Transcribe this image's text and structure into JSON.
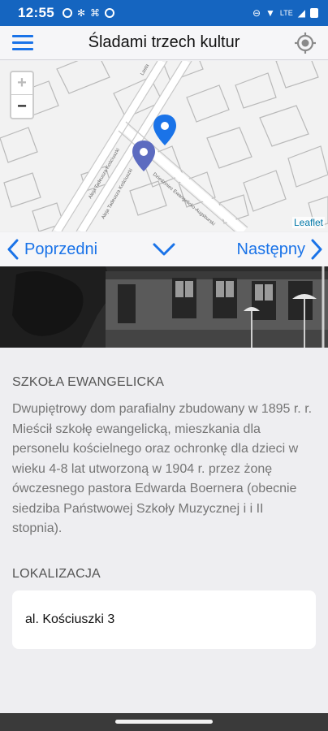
{
  "status_bar": {
    "time": "12:55",
    "network_label": "LTE"
  },
  "app_bar": {
    "title": "Śladami trzech kultur",
    "menu_icon": "hamburger-menu-icon",
    "locate_icon": "gps-locate-icon"
  },
  "map": {
    "attribution": "Leaflet",
    "zoom_in": "+",
    "zoom_out": "−",
    "street_labels": [
      "Lasta",
      "Aleja Tadeusza Kościuszki",
      "Aleja Tadeusza Kościuszki",
      "Dziedziniec Ewangelicko-Augsburski"
    ],
    "marker_active_color": "#1a73e8",
    "marker_inactive_color": "#5c6bc0"
  },
  "navigation": {
    "previous_label": "Poprzedni",
    "next_label": "Następny",
    "accent_color": "#1a73e8"
  },
  "place": {
    "name": "SZKOŁA EWANGELICKA",
    "description": "Dwupiętrowy dom parafialny zbudowany w 1895 r. r. Mieścił szkołę ewangelicką, mieszkania dla personelu kościelnego oraz ochronkę dla dzieci w wieku 4-8 lat utworzoną w 1904 r. przez żonę ówczesnego pastora Edwarda Boernera (obecnie siedziba Państwowej Szkoły Muzycznej i i II stopnia).",
    "location_heading": "LOKALIZACJA",
    "address": "al. Kościuszki 3"
  }
}
